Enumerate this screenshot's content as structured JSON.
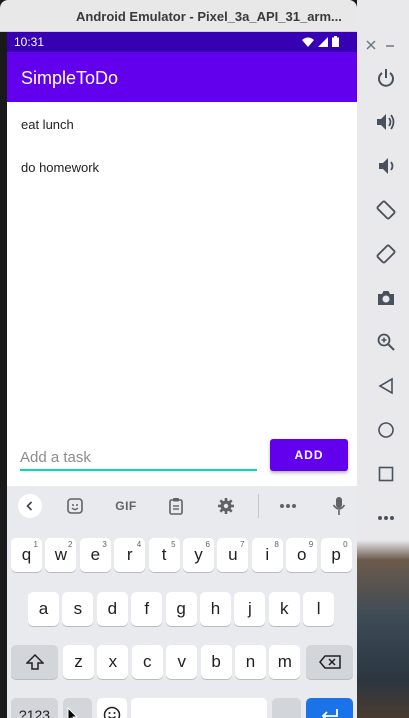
{
  "window": {
    "title": "Android Emulator - Pixel_3a_API_31_arm..."
  },
  "statusbar": {
    "time": "10:31"
  },
  "app": {
    "title": "SimpleToDo"
  },
  "tasks": [
    "eat lunch",
    "do homework"
  ],
  "input": {
    "placeholder": "Add a task",
    "value": ""
  },
  "add_button": {
    "label": "ADD"
  },
  "keyboard": {
    "toolbar": {
      "gif_label": "GIF"
    },
    "row1": [
      {
        "k": "q",
        "s": "1"
      },
      {
        "k": "w",
        "s": "2"
      },
      {
        "k": "e",
        "s": "3"
      },
      {
        "k": "r",
        "s": "4"
      },
      {
        "k": "t",
        "s": "5"
      },
      {
        "k": "y",
        "s": "6"
      },
      {
        "k": "u",
        "s": "7"
      },
      {
        "k": "i",
        "s": "8"
      },
      {
        "k": "o",
        "s": "9"
      },
      {
        "k": "p",
        "s": "0"
      }
    ],
    "row2": [
      "a",
      "s",
      "d",
      "f",
      "g",
      "h",
      "j",
      "k",
      "l"
    ],
    "row3": [
      "z",
      "x",
      "c",
      "v",
      "b",
      "n",
      "m"
    ],
    "symbols_label": "?123",
    "comma_label": ",",
    "period_label": "."
  },
  "colors": {
    "primary": "#6200ee",
    "primary_dark": "#3700b3",
    "accent": "#03dac5",
    "enter_key": "#1a73e8"
  },
  "sidebar_icons": [
    "close-icon",
    "power-icon",
    "volume-up-icon",
    "volume-down-icon",
    "rotate-left-icon",
    "rotate-right-icon",
    "camera-icon",
    "zoom-icon",
    "back-icon",
    "home-icon",
    "overview-icon",
    "more-icon"
  ]
}
